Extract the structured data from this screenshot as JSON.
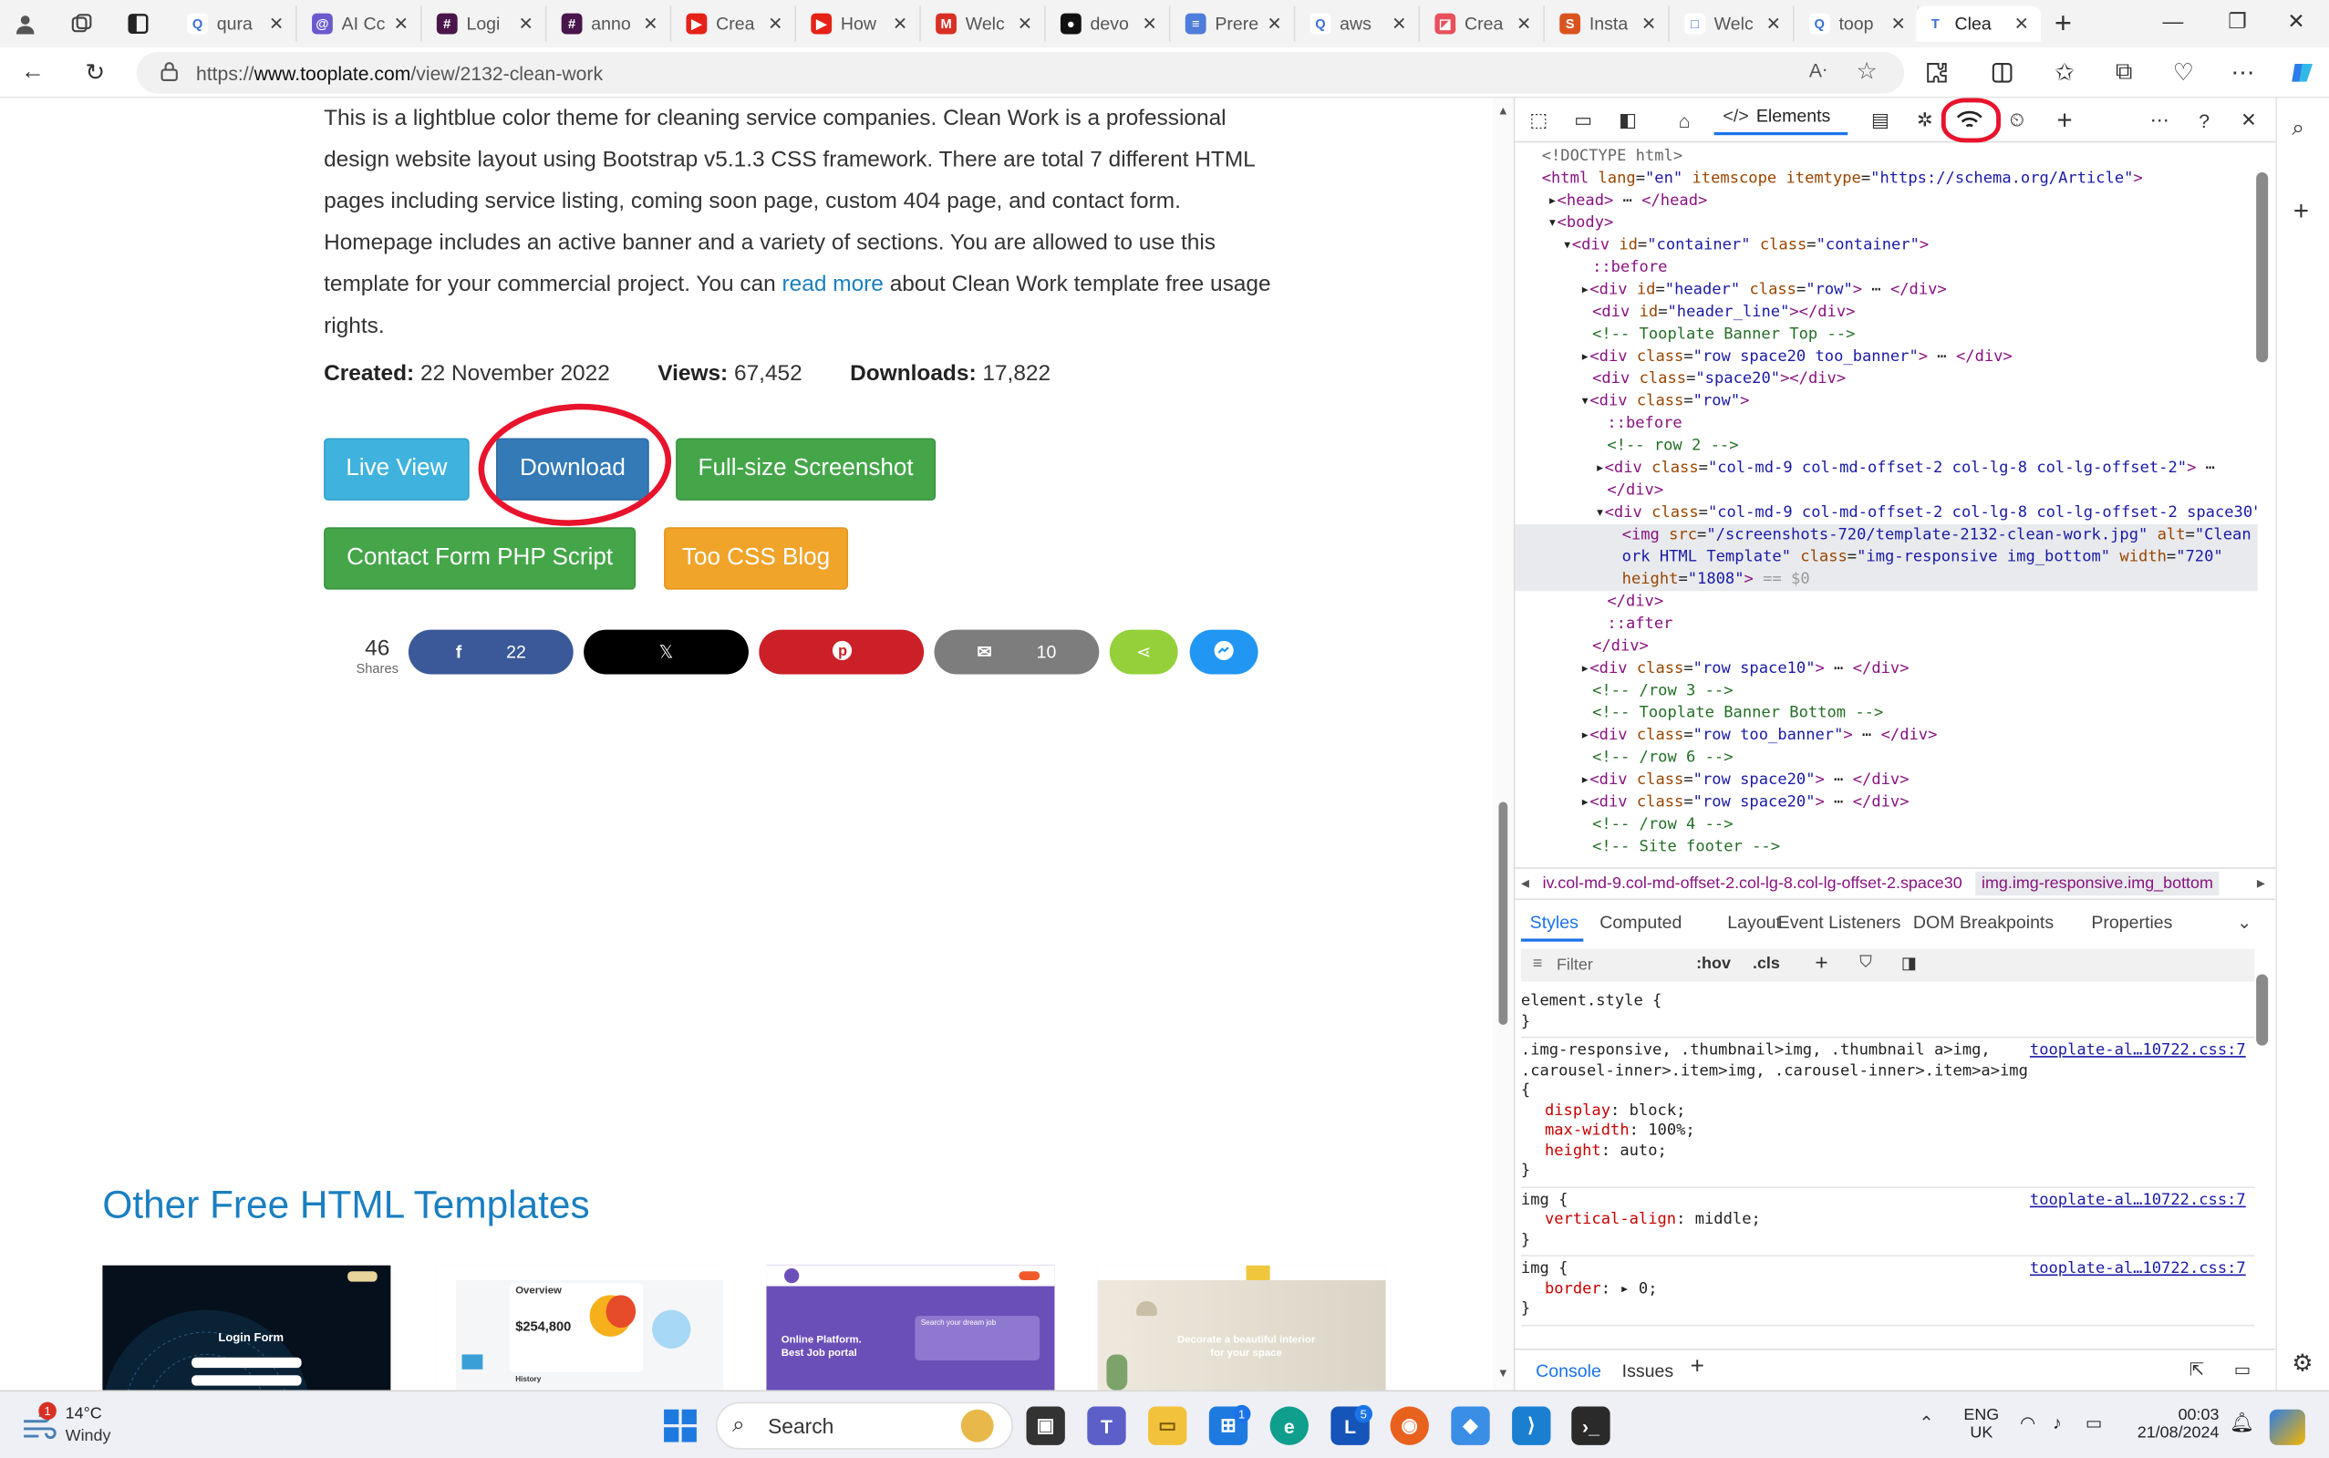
{
  "browser": {
    "tabs": [
      {
        "label": "qura",
        "fav": "Q",
        "color": "#ffffff"
      },
      {
        "label": "AI Cc",
        "fav": "@",
        "color": "#6a5acd"
      },
      {
        "label": "Logi",
        "fav": "#",
        "color": "#4a154b"
      },
      {
        "label": "anno",
        "fav": "#",
        "color": "#4a154b"
      },
      {
        "label": "Crea",
        "fav": "▶",
        "color": "#e62117"
      },
      {
        "label": "How",
        "fav": "▶",
        "color": "#e62117"
      },
      {
        "label": "Welc",
        "fav": "M",
        "color": "#d93025"
      },
      {
        "label": "devo",
        "fav": "●",
        "color": "#111111"
      },
      {
        "label": "Prere",
        "fav": "≡",
        "color": "#4f7ddb"
      },
      {
        "label": "aws",
        "fav": "Q",
        "color": "#ffffff"
      },
      {
        "label": "Crea",
        "fav": "◪",
        "color": "#e8505b"
      },
      {
        "label": "Insta",
        "fav": "S",
        "color": "#d9531e"
      },
      {
        "label": "Welc",
        "fav": "□",
        "color": "#ffffff"
      },
      {
        "label": "toop",
        "fav": "Q",
        "color": "#ffffff"
      },
      {
        "label": "Clea",
        "fav": "T",
        "color": "#ffffff",
        "active": true
      }
    ],
    "url_prefix": "https://",
    "url_host": "www.tooplate.com",
    "url_path": "/view/2132-clean-work"
  },
  "page": {
    "description_1": "This is a lightblue color theme for cleaning service companies. Clean Work is a professional design website layout using Bootstrap v5.1.3 CSS framework. There are total 7 different HTML pages including service listing, coming soon page, custom 404 page, and contact form. Homepage includes an active banner and a variety of sections. You are allowed to use this template for your commercial project. You can ",
    "read_more": "read more",
    "description_2": " about Clean Work template free usage rights.",
    "created_label": "Created:",
    "created_value": "22 November 2022",
    "views_label": "Views:",
    "views_value": "67,452",
    "downloads_label": "Downloads:",
    "downloads_value": "17,822",
    "buttons": {
      "live_view": "Live View",
      "download": "Download",
      "screenshot": "Full-size Screenshot",
      "contact_form": "Contact Form PHP Script",
      "css_blog": "Too CSS Blog"
    },
    "shares": {
      "count": "46",
      "label": "Shares",
      "facebook": "22",
      "email": "10"
    },
    "other_title": "Other Free HTML Templates",
    "thumbs": {
      "t1": "Login Form",
      "t2_title": "Overview",
      "t2_value": "$254,800",
      "t2_sub": "History",
      "t3_line1": "Online Platform.",
      "t3_line2": "Best Job portal",
      "t3_search": "Search your dream job",
      "t4_line1": "Decorate a beautiful interior",
      "t4_line2": "for your space"
    }
  },
  "devtools": {
    "elements_tab": "Elements",
    "breadcrumb_left": "iv.col-md-9.col-md-offset-2.col-lg-8.col-lg-offset-2.space30",
    "breadcrumb_current": "img.img-responsive.img_bottom",
    "sub_tabs": [
      "Styles",
      "Computed",
      "Layout",
      "Event Listeners",
      "DOM Breakpoints",
      "Properties"
    ],
    "filter_placeholder": "Filter",
    "hov": ":hov",
    "cls": ".cls",
    "drawer_tabs": [
      "Console",
      "Issues"
    ],
    "css_source": "tooplate-al…10722.css:7"
  },
  "taskbar": {
    "weather_temp": "14°C",
    "weather_desc": "Windy",
    "weather_badge": "1",
    "search": "Search",
    "lang1": "ENG",
    "lang2": "UK",
    "time": "00:03",
    "date": "21/08/2024"
  }
}
